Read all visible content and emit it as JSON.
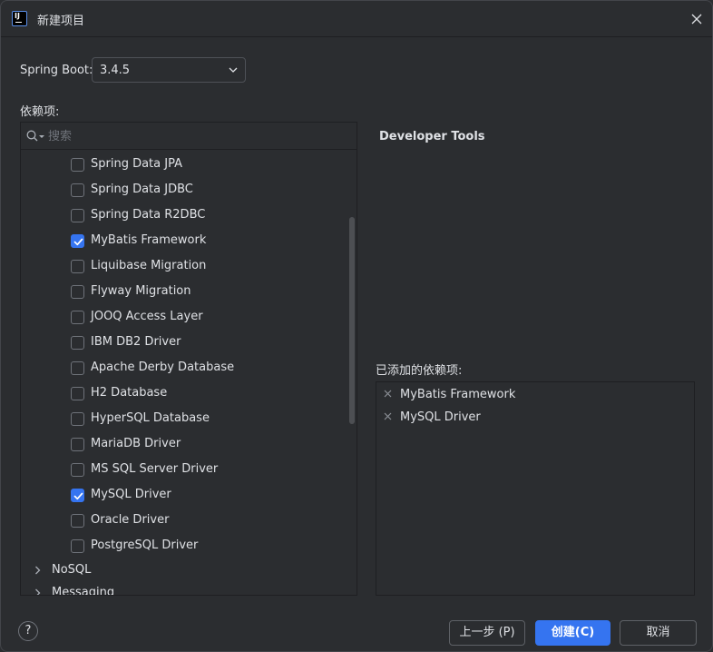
{
  "window": {
    "title": "新建项目"
  },
  "spring_boot": {
    "label": "Spring Boot:",
    "version": "3.4.5"
  },
  "dependencies_label": "依赖项:",
  "search": {
    "placeholder": "搜索",
    "value": ""
  },
  "dependency_list": [
    {
      "label": "Spring Data JPA",
      "checked": false
    },
    {
      "label": "Spring Data JDBC",
      "checked": false
    },
    {
      "label": "Spring Data R2DBC",
      "checked": false
    },
    {
      "label": "MyBatis Framework",
      "checked": true
    },
    {
      "label": "Liquibase Migration",
      "checked": false
    },
    {
      "label": "Flyway Migration",
      "checked": false
    },
    {
      "label": "JOOQ Access Layer",
      "checked": false
    },
    {
      "label": "IBM DB2 Driver",
      "checked": false
    },
    {
      "label": "Apache Derby Database",
      "checked": false
    },
    {
      "label": "H2 Database",
      "checked": false
    },
    {
      "label": "HyperSQL Database",
      "checked": false
    },
    {
      "label": "MariaDB Driver",
      "checked": false
    },
    {
      "label": "MS SQL Server Driver",
      "checked": false
    },
    {
      "label": "MySQL Driver",
      "checked": true
    },
    {
      "label": "Oracle Driver",
      "checked": false
    },
    {
      "label": "PostgreSQL Driver",
      "checked": false
    }
  ],
  "categories": [
    {
      "label": "NoSQL",
      "expanded": false
    },
    {
      "label": "Messaging",
      "expanded": false
    }
  ],
  "detail": {
    "title": "Developer Tools"
  },
  "added": {
    "label": "已添加的依赖项:",
    "items": [
      {
        "label": "MyBatis Framework"
      },
      {
        "label": "MySQL Driver"
      }
    ]
  },
  "buttons": {
    "help": "?",
    "previous": "上一步 (P)",
    "create": "创建(C)",
    "cancel": "取消"
  },
  "colors": {
    "background": "#2b2d30",
    "accent": "#3574f0",
    "text": "#dfe1e5",
    "placeholder": "#6f737a"
  }
}
